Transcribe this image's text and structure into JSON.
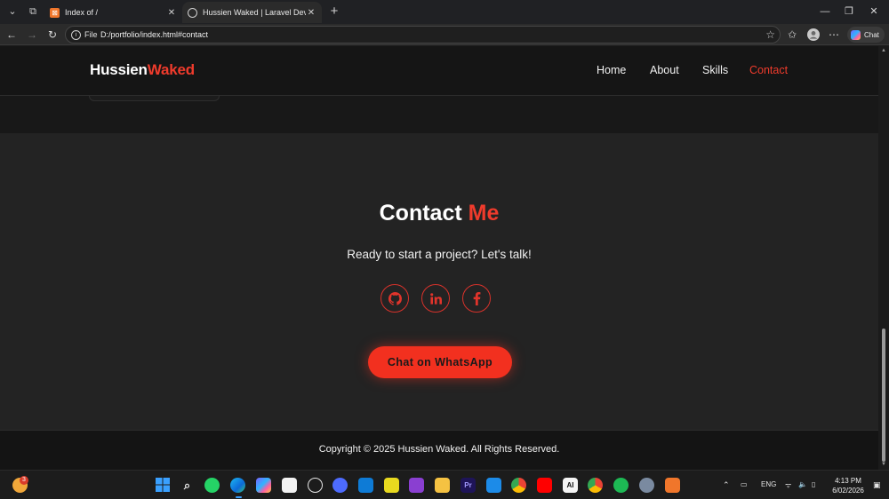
{
  "browser": {
    "tabs": [
      {
        "title": "Index of /",
        "active": false
      },
      {
        "title": "Hussien Waked | Laravel Developer",
        "active": true
      }
    ],
    "new_tab_label": "+",
    "address": {
      "scheme_label": "File",
      "url": "D:/portfolio/index.html#contact"
    },
    "chat_label": "Chat"
  },
  "site": {
    "brand": {
      "first": "Hussien",
      "second": "Waked"
    },
    "nav": [
      {
        "label": "Home",
        "active": false
      },
      {
        "label": "About",
        "active": false
      },
      {
        "label": "Skills",
        "active": false
      },
      {
        "label": "Contact",
        "active": true
      }
    ],
    "contact": {
      "title_first": "Contact",
      "title_second": "Me",
      "subtitle": "Ready to start a project? Let's talk!",
      "socials": [
        "github-icon",
        "linkedin-icon",
        "facebook-icon"
      ],
      "whatsapp_label": "Chat on WhatsApp"
    },
    "footer": {
      "copyright": "Copyright © 2025 Hussien Waked. All Rights Reserved."
    },
    "colors": {
      "accent": "#ef3b2c",
      "button": "#f2301f",
      "section_bg": "#232323",
      "header_bg": "#151515"
    }
  },
  "taskbar": {
    "weather_badge": "3",
    "tray_language": "ENG",
    "time": "4:13 PM",
    "date": "6/02/2026"
  }
}
